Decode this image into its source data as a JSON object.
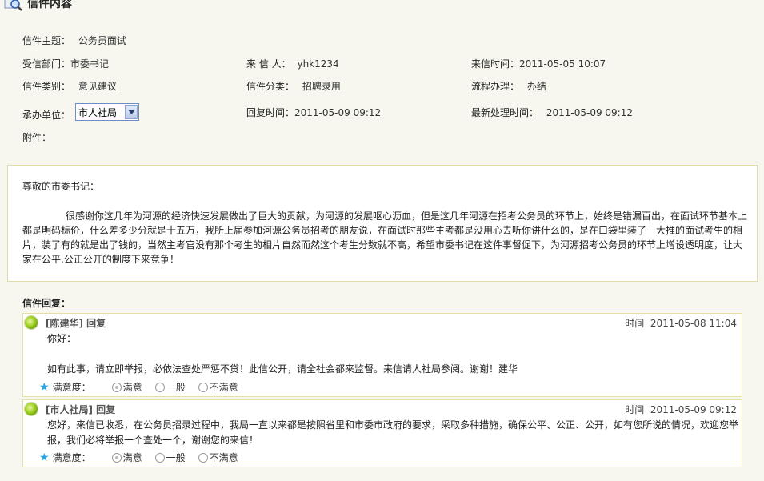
{
  "header": {
    "title": "信件内容",
    "icon": "magnifier-icon"
  },
  "meta": {
    "subject_label": "信件主题：",
    "subject": "公务员面试",
    "dept_label": "受信部门：",
    "dept": "市委书记",
    "sender_label": "来 信 人：",
    "sender": "yhk1234",
    "recv_time_label": "来信时间：",
    "recv_time": "2011-05-05 10:07",
    "category_label": "信件类别：",
    "category": "意见建议",
    "class_label": "信件分类：",
    "class": "招聘录用",
    "process_label": "流程办理：",
    "process": "办结",
    "handler_label": "承办单位：",
    "handler": "市人社局",
    "reply_time_label": "回复时间：",
    "reply_time": "2011-05-09 09:12",
    "latest_label": "最新处理时间：",
    "latest": "2011-05-09 09:12",
    "attach_label": "附件："
  },
  "letter": {
    "greeting": "尊敬的市委书记：",
    "body": "很感谢你这几年为河源的经济快速发展做出了巨大的贡献，为河源的发展呕心沥血，但是这几年河源在招考公务员的环节上，始终是错漏百出，在面试环节基本上都是明码标价，什么差多少分就是十五万，我所上届参加河源公务员招考的朋友说，在面试时那些主考都是没用心去听你讲什么的，是在口袋里装了一大推的面试考生的相片，装了有的就是出了钱的，当然主考官没有那个考生的相片自然而然这个考生分数就不高，希望市委书记在这件事督促下，为河源招考公务员的环节上增设透明度，让大家在公平.公正公开的制度下来竞争！"
  },
  "replies_title": "信件回复：",
  "replies": [
    {
      "author": "[陈建华] 回复",
      "time_label": "时间",
      "time": "2011-05-08 11:04",
      "line1": "你好：",
      "line2": "",
      "line3": "如有此事，请立即举报，必依法查处严惩不贷！此信公开，请全社会都来监督。来信请人社局参阅。谢谢！建华",
      "sat_label": "满意度：",
      "options": [
        "满意",
        "一般",
        "不满意"
      ]
    },
    {
      "author": "[市人社局] 回复",
      "time_label": "时间",
      "time": "2011-05-09 09:12",
      "line1": "您好，来信已收悉，在公务员招录过程中，我局一直以来都是按照省里和市委市政府的要求，采取多种措施，确保公平、公正、公开，如有您所说的情况，欢迎您举报，我们必将举报一个查处一个，谢谢您的来信！",
      "sat_label": "满意度：",
      "options": [
        "满意",
        "一般",
        "不满意"
      ]
    }
  ]
}
